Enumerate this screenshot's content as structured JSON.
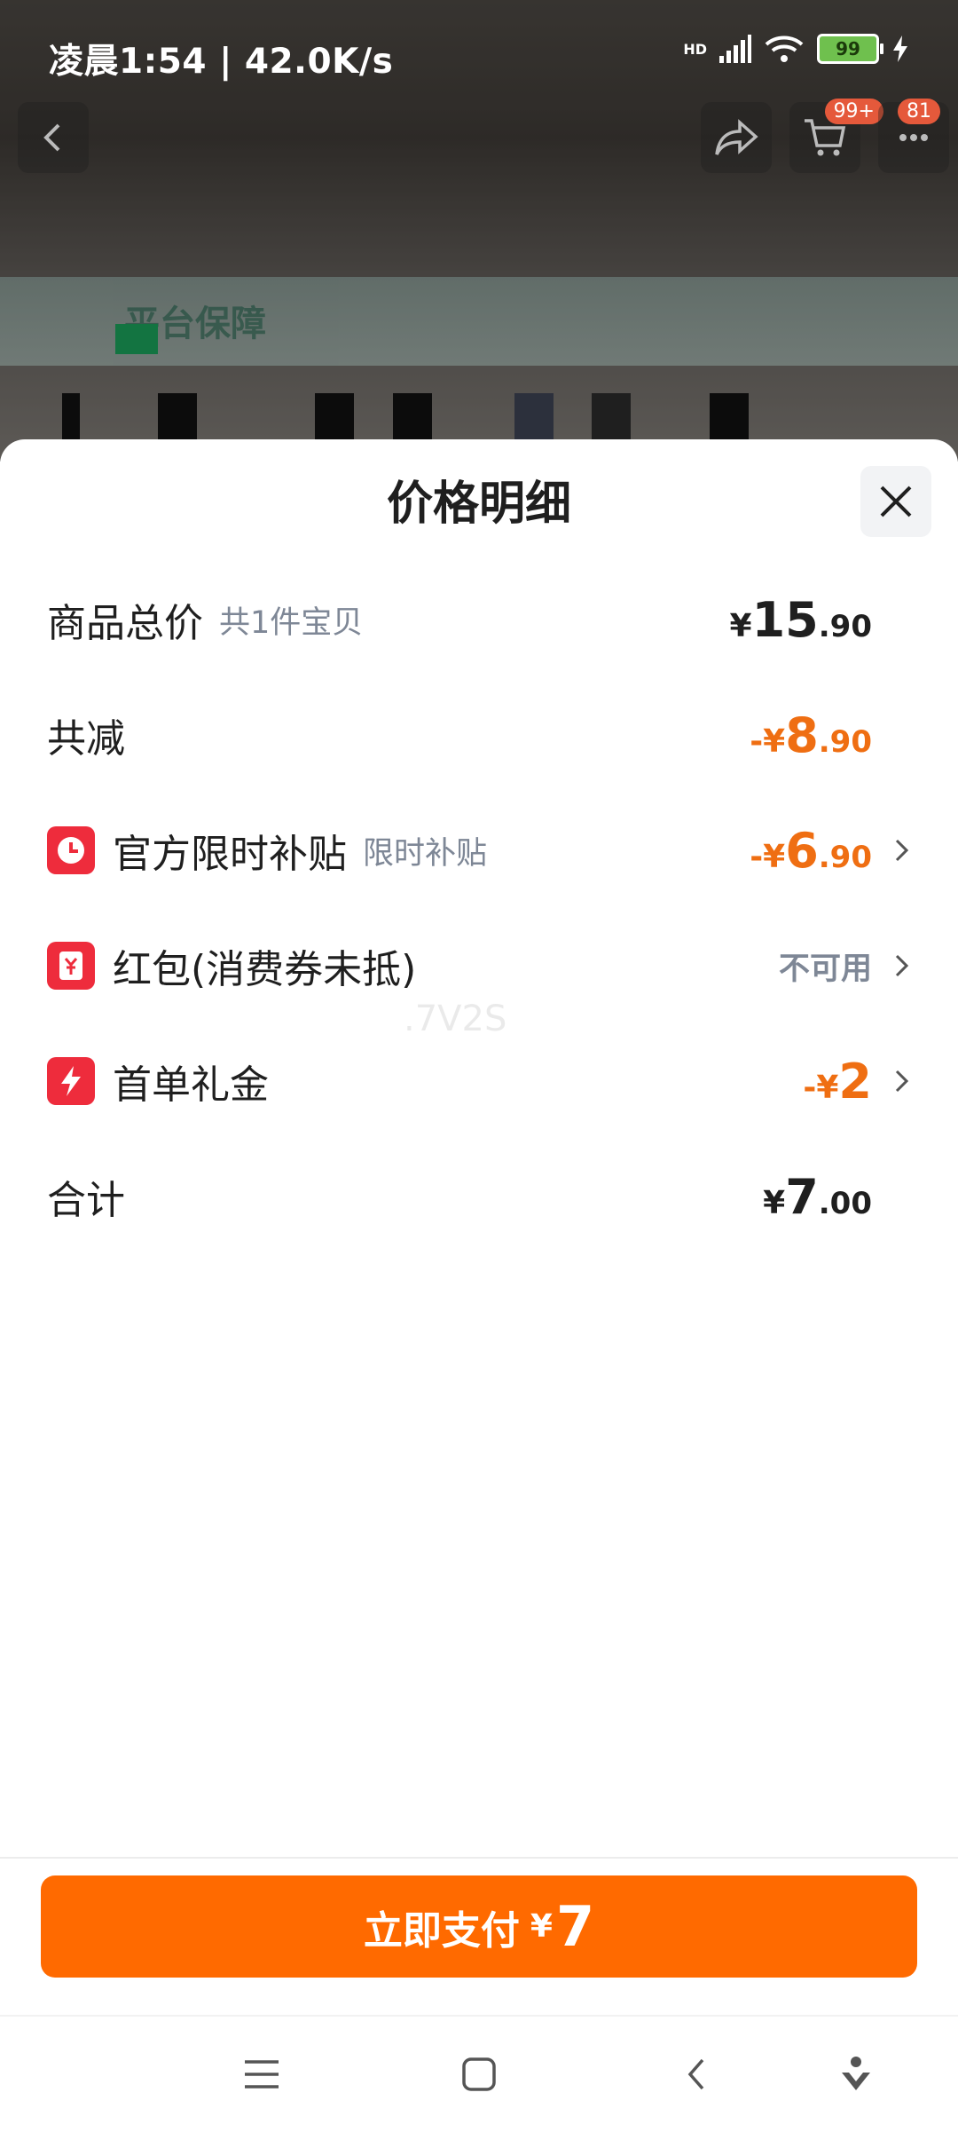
{
  "status": {
    "time_speed": "凌晨1:54 | 42.0K/s",
    "network": "HD",
    "battery": "99"
  },
  "background": {
    "cart_badge": "99+",
    "msg_badge": "81",
    "guarantee_text": "平台保障"
  },
  "sheet": {
    "title": "价格明细",
    "rows": [
      {
        "label": "商品总价",
        "sub": "共1件宝贝",
        "cur": "¥",
        "int": "15",
        "dec": ".90"
      },
      {
        "label": "共减",
        "cur": "-¥",
        "int": "8",
        "dec": ".90"
      },
      {
        "label": "官方限时补贴",
        "sub": "限时补贴",
        "cur": "-¥",
        "int": "6",
        "dec": ".90",
        "icon": "clock-icon"
      },
      {
        "label": "红包(消费券未抵)",
        "value_text": "不可用",
        "icon": "red-packet-icon"
      },
      {
        "label": "首单礼金",
        "cur": "-¥",
        "int": "2",
        "icon": "bolt-icon"
      },
      {
        "label": "合计",
        "cur": "¥",
        "int": "7",
        "dec": ".00"
      }
    ],
    "watermark": ".7V2S"
  },
  "pay_button": {
    "label": "立即支付",
    "currency": "¥",
    "amount": "7"
  },
  "colors": {
    "accent": "#ff6a00",
    "discount": "#ef6e12",
    "icon_red": "#ee2c3c"
  }
}
